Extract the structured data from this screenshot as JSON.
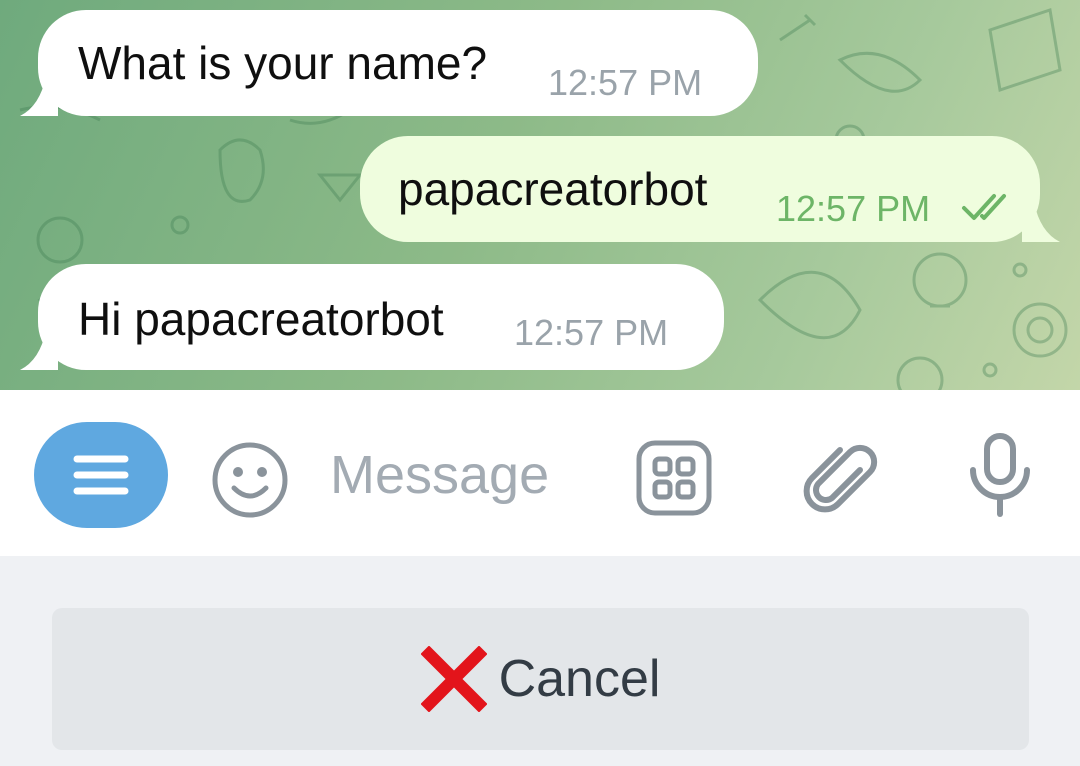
{
  "messages": [
    {
      "direction": "incoming",
      "text": "What is your name?",
      "time": "12:57 PM"
    },
    {
      "direction": "outgoing",
      "text": "papacreatorbot",
      "time": "12:57 PM",
      "status": "read"
    },
    {
      "direction": "incoming",
      "text": "Hi papacreatorbot",
      "time": "12:57 PM"
    }
  ],
  "input_bar": {
    "placeholder": "Message",
    "value": "",
    "icons": [
      "menu-icon",
      "emoji-icon",
      "bot-commands-icon",
      "paperclip-icon",
      "microphone-icon"
    ]
  },
  "keyboard": {
    "cancel_label": "Cancel",
    "cancel_icon": "red-x-icon"
  },
  "colors": {
    "incoming_bubble": "#ffffff",
    "outgoing_bubble": "#effdde",
    "outgoing_time": "#6db567",
    "menu_button": "#5fa8e0",
    "cancel_x": "#e3141b"
  }
}
